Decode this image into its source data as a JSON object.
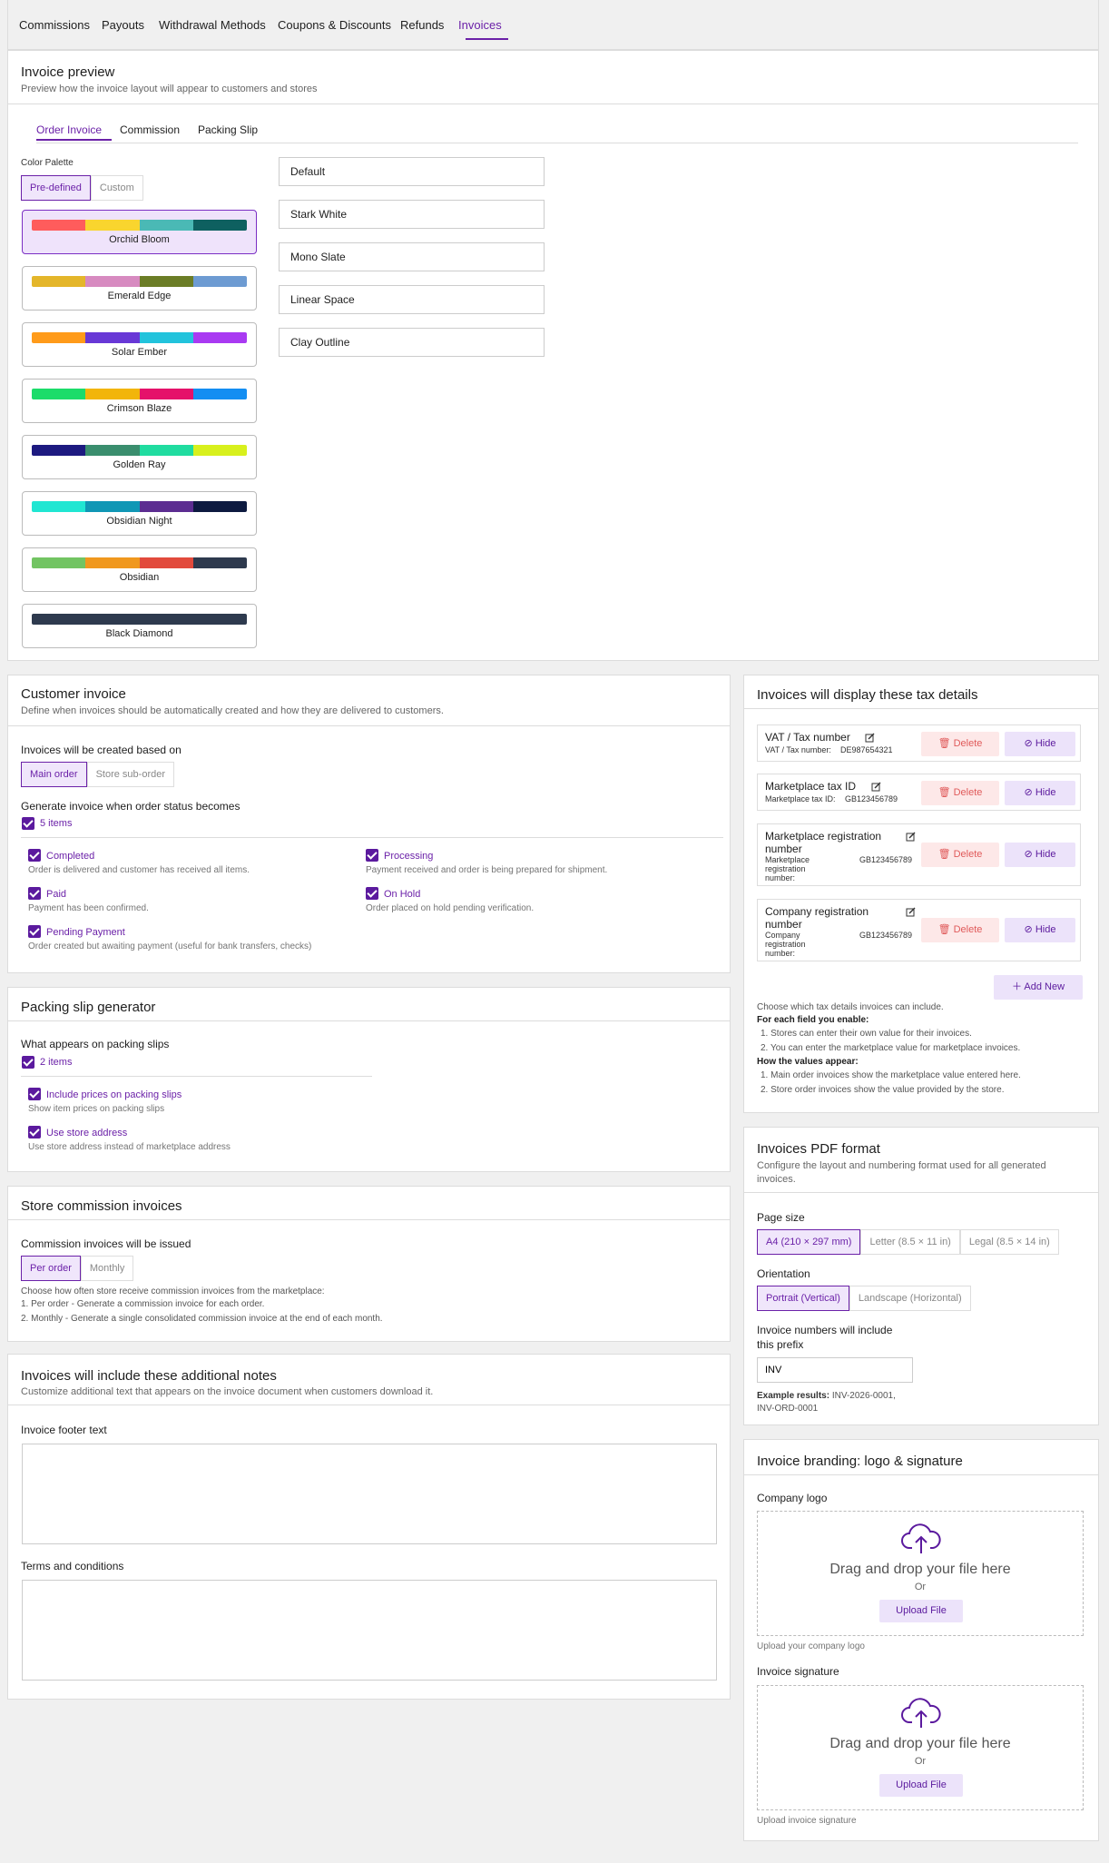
{
  "top_tabs": [
    "Commissions",
    "Payouts",
    "Withdrawal Methods",
    "Coupons & Discounts",
    "Refunds",
    "Invoices"
  ],
  "preview": {
    "title": "Invoice preview",
    "subtitle": "Preview how the invoice layout will appear to customers and stores",
    "tabs": [
      "Order Invoice",
      "Commission",
      "Packing Slip"
    ],
    "palette_label": "Color Palette",
    "palette_modes": [
      "Pre-defined",
      "Custom"
    ],
    "palettes": [
      {
        "name": "Orchid Bloom",
        "colors": [
          "#ff5c5c",
          "#f9d52e",
          "#4ab9b5",
          "#0e6060"
        ]
      },
      {
        "name": "Emerald Edge",
        "colors": [
          "#e4b62a",
          "#d78ac0",
          "#6b7d26",
          "#6d9bd2"
        ]
      },
      {
        "name": "Solar Ember",
        "colors": [
          "#ff9b1a",
          "#6838d6",
          "#22c3dc",
          "#a93af2"
        ]
      },
      {
        "name": "Crimson Blaze",
        "colors": [
          "#1bdc6a",
          "#f2b50a",
          "#e5116a",
          "#138ef2"
        ]
      },
      {
        "name": "Golden Ray",
        "colors": [
          "#1d1a80",
          "#3a8e6e",
          "#20dca0",
          "#d8f01d"
        ]
      },
      {
        "name": "Obsidian Night",
        "colors": [
          "#20e6d2",
          "#1097b5",
          "#5c2d91",
          "#0d1a40"
        ]
      },
      {
        "name": "Obsidian",
        "colors": [
          "#72c462",
          "#f0981e",
          "#e24a3c",
          "#2e3a4e"
        ]
      },
      {
        "name": "Black Diamond",
        "colors": [
          "#2e3a4e",
          "#2e3a4e",
          "#2e3a4e",
          "#2e3a4e"
        ]
      }
    ],
    "templates": [
      "Default",
      "Stark White",
      "Mono Slate",
      "Linear Space",
      "Clay Outline"
    ]
  },
  "customer_invoice": {
    "title": "Customer invoice",
    "subtitle": "Define when invoices should be automatically created and how they are delivered to customers.",
    "based_on_label": "Invoices will be created based on",
    "based_on_options": [
      "Main order",
      "Store sub-order"
    ],
    "status_label": "Generate invoice when order status becomes",
    "count": "5 items",
    "statuses": [
      {
        "name": "Completed",
        "desc": "Order is delivered and customer has received all items."
      },
      {
        "name": "Processing",
        "desc": "Payment received and order is being prepared for shipment."
      },
      {
        "name": "Paid",
        "desc": "Payment has been confirmed."
      },
      {
        "name": "On Hold",
        "desc": "Order placed on hold pending verification."
      },
      {
        "name": "Pending Payment",
        "desc": "Order created but awaiting payment (useful for bank transfers, checks)"
      }
    ]
  },
  "packing": {
    "title": "Packing slip generator",
    "label": "What appears on packing slips",
    "count": "2 items",
    "items": [
      {
        "name": "Include prices on packing slips",
        "desc": "Show item prices on packing slips"
      },
      {
        "name": "Use store address",
        "desc": "Use store address instead of marketplace address"
      }
    ]
  },
  "commission": {
    "title": "Store commission invoices",
    "label": "Commission invoices will be issued",
    "options": [
      "Per order",
      "Monthly"
    ],
    "help": [
      "Choose how often store receive commission invoices from the marketplace:",
      "1. Per order - Generate a commission invoice for each order.",
      "2. Monthly - Generate a single consolidated commission invoice at the end of each month."
    ]
  },
  "notes": {
    "title": "Invoices will include these additional notes",
    "subtitle": "Customize additional text that appears on the invoice document when customers download it.",
    "footer_label": "Invoice footer text",
    "terms_label": "Terms and conditions"
  },
  "tax": {
    "title": "Invoices will display these tax details",
    "delete_label": "Delete",
    "hide_label": "Hide",
    "items": [
      {
        "name": "VAT / Tax number",
        "field": "VAT / Tax number:",
        "value": "DE987654321"
      },
      {
        "name": "Marketplace tax ID",
        "field": "Marketplace tax ID:",
        "value": "GB123456789"
      },
      {
        "name": "Marketplace registration number",
        "field": "Marketplace registration number:",
        "value": "GB123456789"
      },
      {
        "name": "Company registration number",
        "field": "Company registration number:",
        "value": "GB123456789"
      }
    ],
    "add_new": "Add New",
    "help": [
      "Choose which tax details invoices can include.",
      "For each field you enable:",
      "1. Stores can enter their own value for their invoices.",
      "2. You can enter the marketplace value for marketplace invoices.",
      "How the values appear:",
      "1. Main order invoices show the marketplace value entered here.",
      "2. Store order invoices show the value provided by the store."
    ]
  },
  "pdf": {
    "title": "Invoices PDF format",
    "subtitle": "Configure the layout and numbering format used for all generated invoices.",
    "page_size_label": "Page size",
    "page_sizes": [
      "A4 (210 × 297 mm)",
      "Letter (8.5 × 11 in)",
      "Legal (8.5 × 14 in)"
    ],
    "orientation_label": "Orientation",
    "orientations": [
      "Portrait (Vertical)",
      "Landscape (Horizontal)"
    ],
    "prefix_label": "Invoice numbers will include this prefix",
    "prefix_value": "INV",
    "example_label": "Example results:",
    "example_values": "INV-2026-0001, INV-ORD-0001"
  },
  "branding": {
    "title": "Invoice branding: logo & signature",
    "logo_label": "Company logo",
    "signature_label": "Invoice signature",
    "drop_text": "Drag and drop your file here",
    "or": "Or",
    "upload": "Upload File",
    "logo_help": "Upload your company logo",
    "signature_help": "Upload invoice signature"
  },
  "colors": {
    "accent": "#6b21a8",
    "delete_bg": "#fde8e8",
    "delete_fg": "#e05a5a",
    "hide_bg": "#ece3fa"
  }
}
